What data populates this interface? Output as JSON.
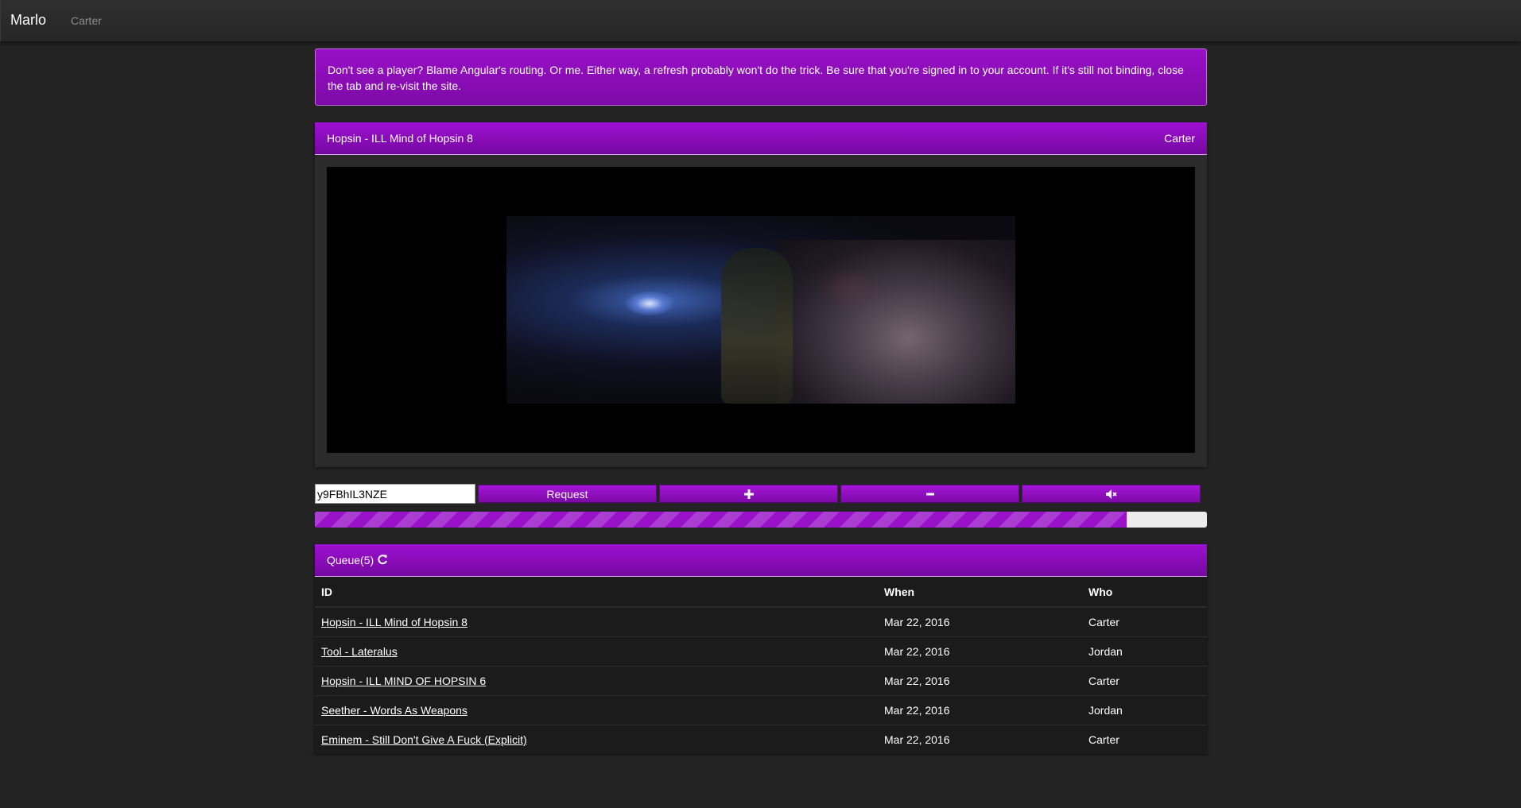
{
  "navbar": {
    "brand": "Marlo",
    "user": "Carter"
  },
  "alert": {
    "text": "Don't see a player? Blame Angular's routing. Or me. Either way, a refresh probably won't do the trick. Be sure that you're signed in to your account. If it's still not binding, close the tab and re-visit the site."
  },
  "player": {
    "title": "Hopsin - ILL Mind of Hopsin 8",
    "requested_by": "Carter"
  },
  "controls": {
    "video_id_value": "y9FBhIL3NZE",
    "request_label": "Request",
    "volume_up_icon": "plus-icon",
    "volume_down_icon": "minus-icon",
    "mute_icon": "volume-mute-icon",
    "progress_fraction": 0.91
  },
  "queue": {
    "title": "Queue(5)",
    "refresh_icon": "refresh-icon",
    "columns": [
      "ID",
      "When",
      "Who"
    ],
    "rows": [
      {
        "id": "Hopsin - ILL Mind of Hopsin 8",
        "when": "Mar 22, 2016",
        "who": "Carter"
      },
      {
        "id": "Tool - Lateralus",
        "when": "Mar 22, 2016",
        "who": "Jordan"
      },
      {
        "id": "Hopsin - ILL MIND OF HOPSIN 6",
        "when": "Mar 22, 2016",
        "who": "Carter"
      },
      {
        "id": "Seether - Words As Weapons",
        "when": "Mar 22, 2016",
        "who": "Jordan"
      },
      {
        "id": "Eminem - Still Don't Give A Fuck (Explicit)",
        "when": "Mar 22, 2016",
        "who": "Carter"
      }
    ]
  },
  "colors": {
    "accent": "#8e0cbd",
    "background": "#232323",
    "navbar": "#2b2b2b"
  }
}
